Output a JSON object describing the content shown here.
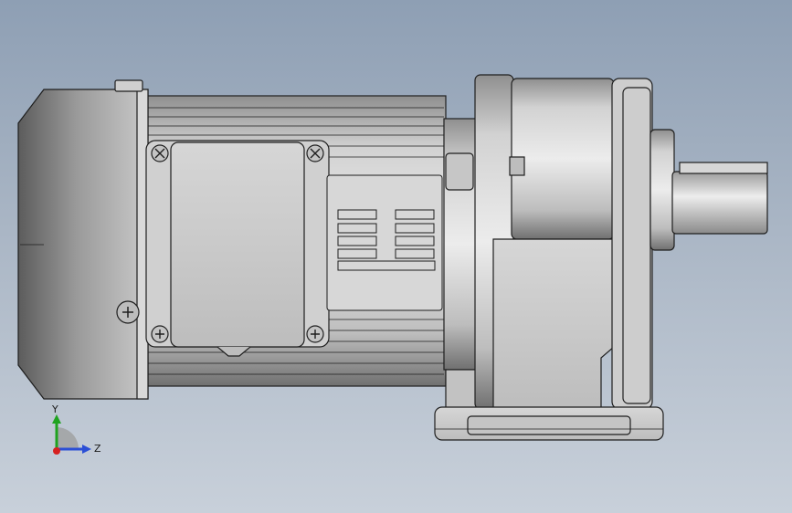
{
  "viewport": {
    "background_top": "#8e9fb4",
    "background_bottom": "#c8d0da",
    "model_name": "gear-motor",
    "model_color": "#c8c8c8",
    "edge_color": "#1e1e1e"
  },
  "triad": {
    "y_label": "Y",
    "z_label": "Z",
    "y_color": "#1fa31f",
    "z_color": "#2b4fd6",
    "x_color": "#d62020"
  }
}
